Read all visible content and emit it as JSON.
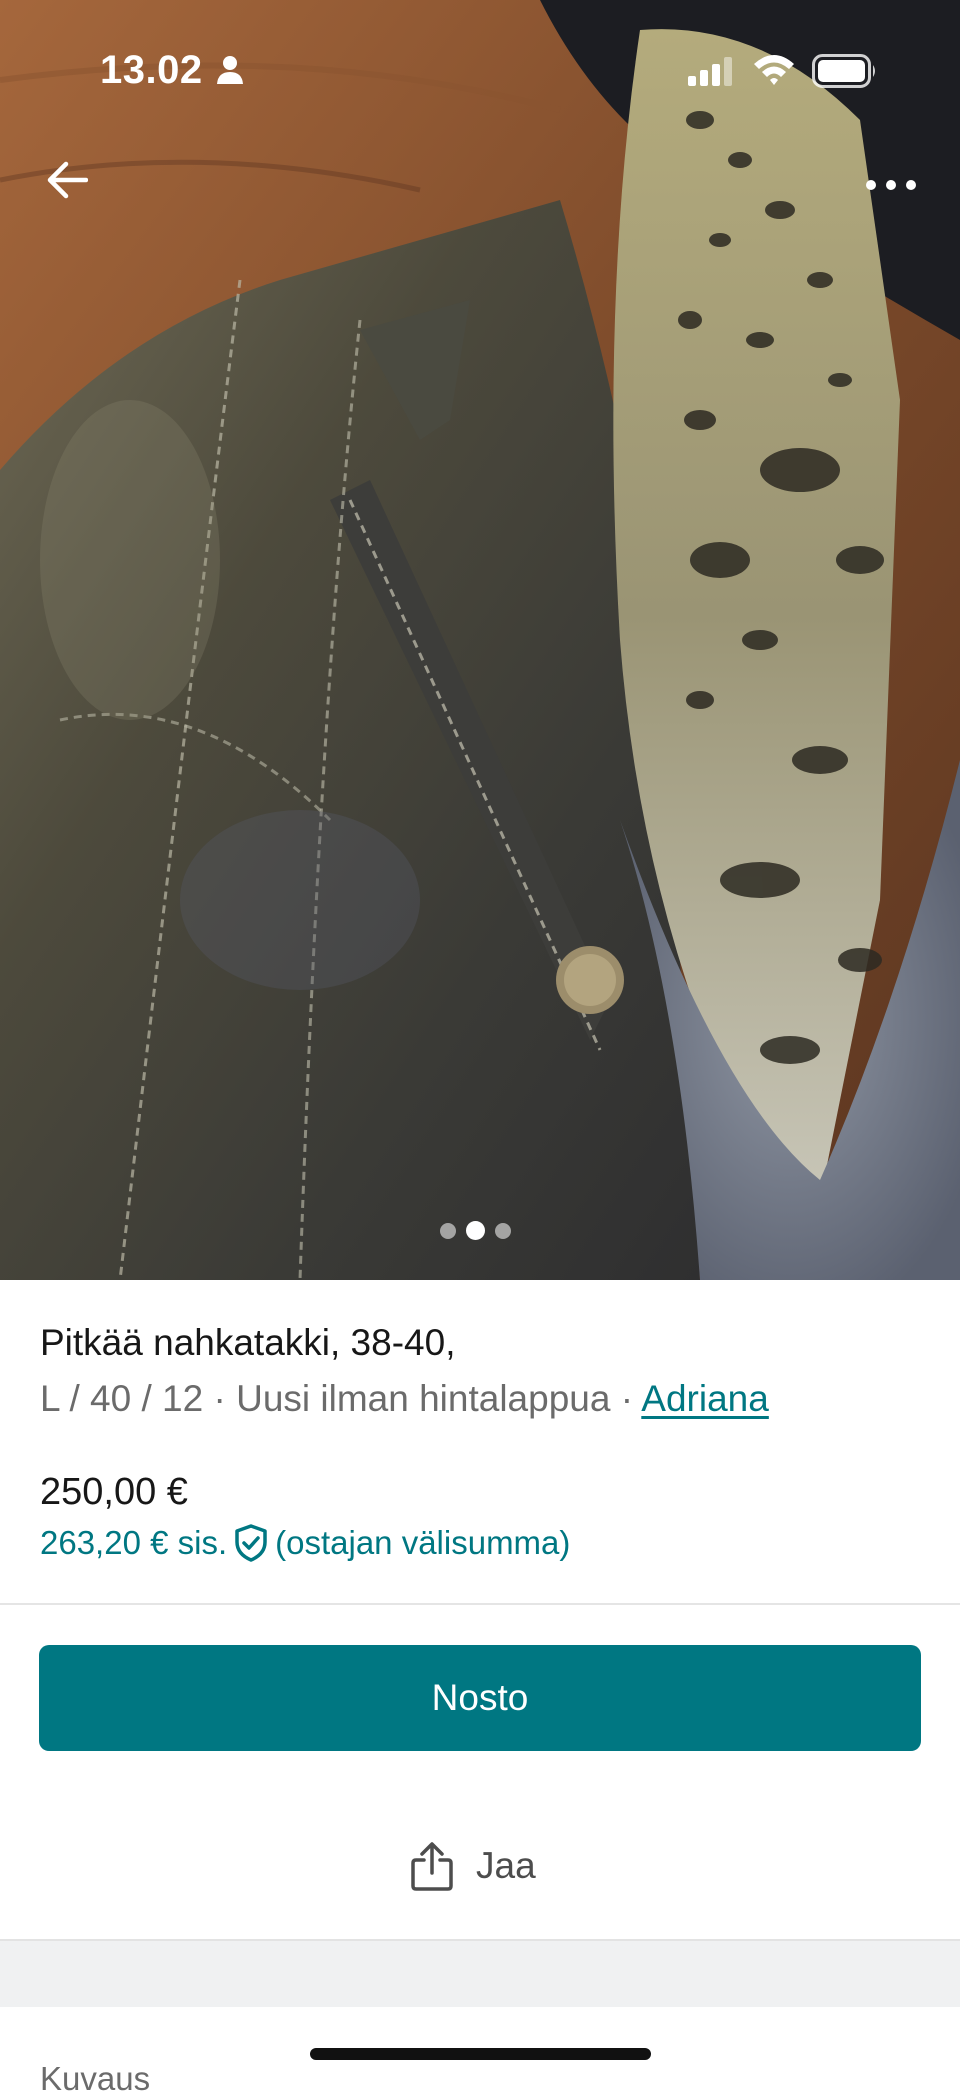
{
  "status_bar": {
    "time": "13.02"
  },
  "hero": {
    "image_description_icon": "photo",
    "pager": {
      "count": 3,
      "active_index": 1
    }
  },
  "item": {
    "title": "Pitkää nahkatakki, 38-40,",
    "size": "L / 40 / 12",
    "separator": "·",
    "condition": "Uusi ilman hintalappua",
    "brand": "Adriana",
    "price": "250,00 €",
    "price_incl": "263,20 € sis.",
    "price_incl_note": "(ostajan välisumma)"
  },
  "actions": {
    "bump_label": "Nosto",
    "share_label": "Jaa"
  },
  "description_section_label": "Kuvaus",
  "colors": {
    "accent": "#007782",
    "text": "#171717",
    "muted": "#6b6b6b"
  },
  "icons": [
    "back-arrow-icon",
    "more-icon",
    "person-icon",
    "signal-icon",
    "wifi-icon",
    "battery-icon",
    "shield-check-icon",
    "share-icon"
  ]
}
